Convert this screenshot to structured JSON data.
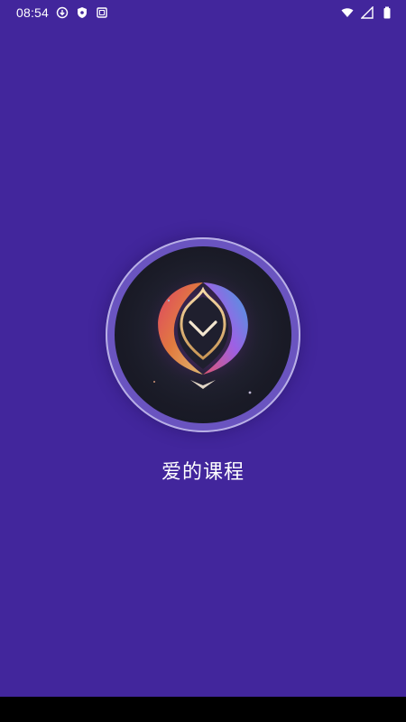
{
  "status_bar": {
    "time": "08:54",
    "left_icons": [
      "download-icon",
      "shield-icon",
      "screenshot-icon"
    ],
    "right_icons": [
      "wifi-icon",
      "signal-icon",
      "battery-icon"
    ]
  },
  "app": {
    "title": "爱的课程"
  },
  "colors": {
    "background": "#42269C",
    "ring": "#B9B0E6",
    "nav_bar": "#000000"
  }
}
